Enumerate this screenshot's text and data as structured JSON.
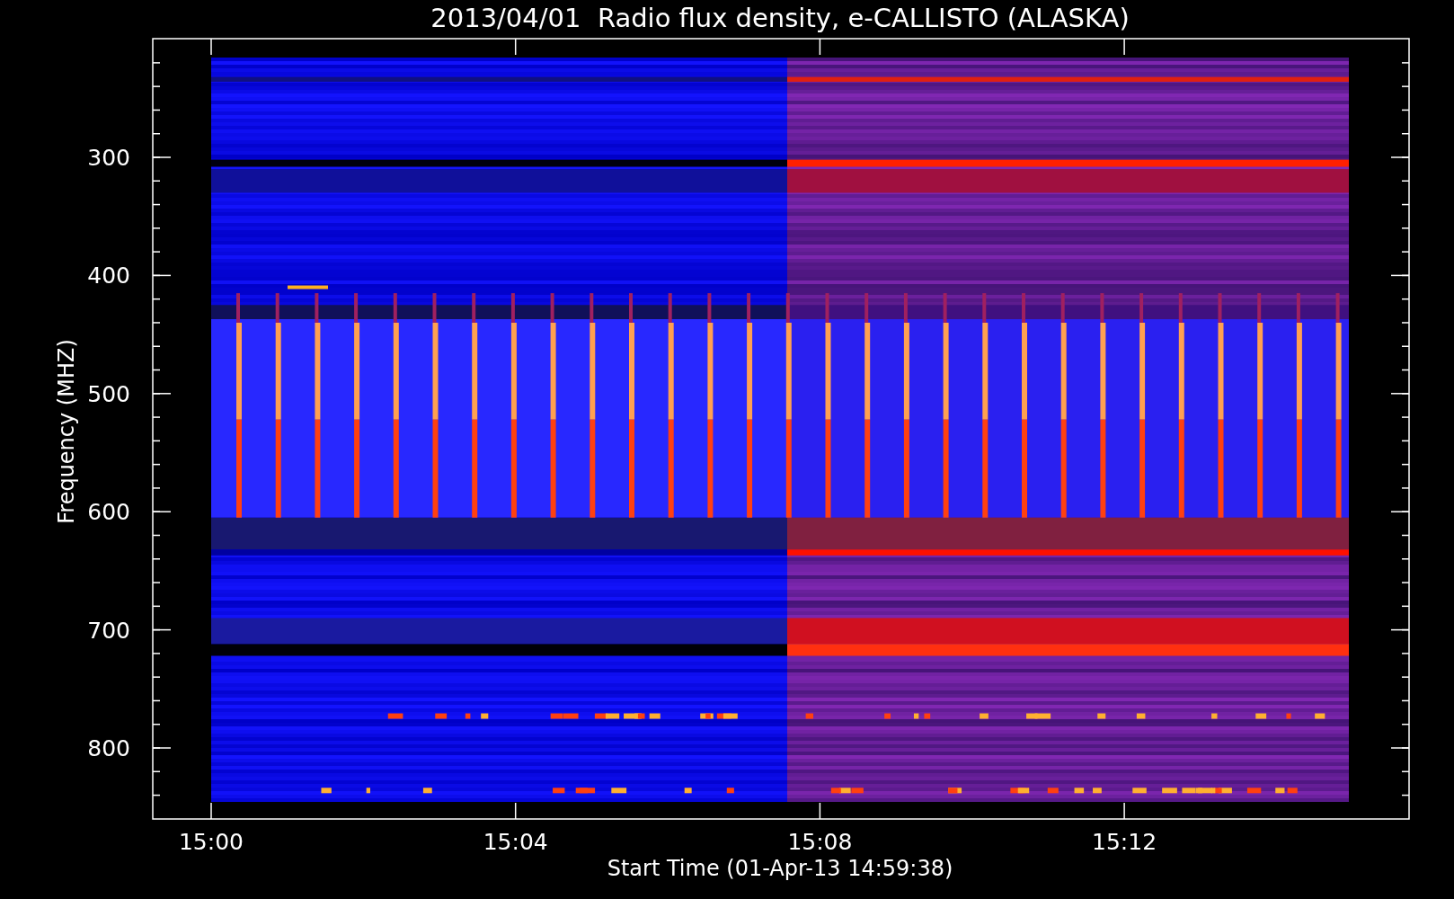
{
  "chart": {
    "title": "2013/04/01  Radio flux density, e-CALLISTO (ALASKA)",
    "ylabel": "Frequency (MHZ)",
    "xlabel": "Start Time (01-Apr-13 14:59:38)",
    "yticks": [
      "300",
      "400",
      "500",
      "600",
      "700",
      "800"
    ],
    "xticks": [
      "15:00",
      "15:04",
      "15:08",
      "15:12"
    ]
  }
}
